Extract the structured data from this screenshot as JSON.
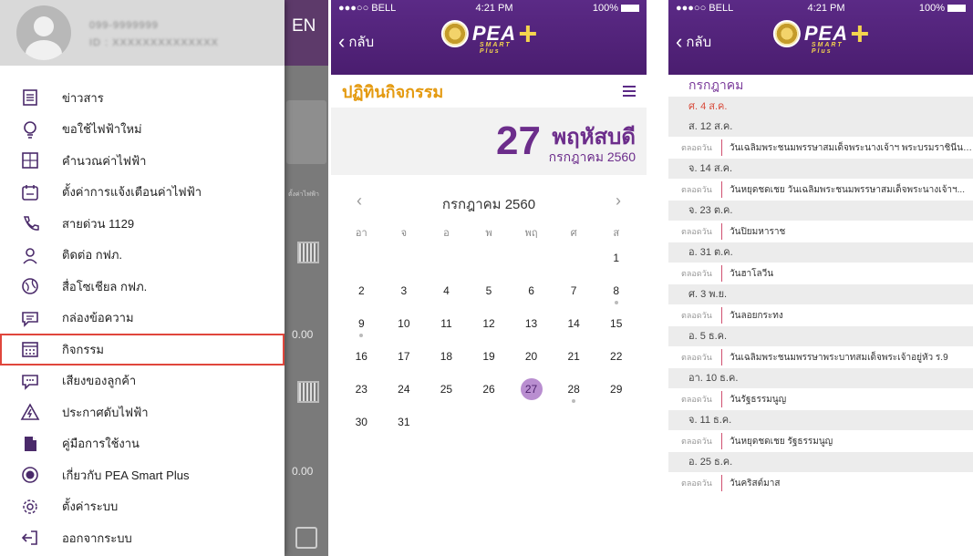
{
  "drawer": {
    "phone": "099-9999999",
    "user_id": "ID : XXXXXXXXXXXXXX",
    "behind_label": "EN",
    "behind_values": [
      "0.00",
      "0.00"
    ],
    "items": [
      {
        "label": "ข่าวสาร",
        "icon": "news-icon"
      },
      {
        "label": "ขอใช้ไฟฟ้าใหม่",
        "icon": "lightbulb-icon"
      },
      {
        "label": "คำนวณค่าไฟฟ้า",
        "icon": "calculator-icon"
      },
      {
        "label": "ตั้งค่าการแจ้งเตือนค่าไฟฟ้า",
        "icon": "bill-alert-icon"
      },
      {
        "label": "สายด่วน 1129",
        "icon": "phone-icon"
      },
      {
        "label": "ติดต่อ กฟภ.",
        "icon": "location-pin-icon"
      },
      {
        "label": "สื่อโซเชียล กฟภ.",
        "icon": "globe-icon"
      },
      {
        "label": "กล่องข้อความ",
        "icon": "message-icon"
      },
      {
        "label": "กิจกรรม",
        "icon": "calendar-icon"
      },
      {
        "label": "เสียงของลูกค้า",
        "icon": "feedback-icon"
      },
      {
        "label": "ประกาศดับไฟฟ้า",
        "icon": "warning-icon"
      },
      {
        "label": "คู่มือการใช้งาน",
        "icon": "manual-icon"
      },
      {
        "label": "เกี่ยวกับ PEA Smart Plus",
        "icon": "pea-logo-icon"
      },
      {
        "label": "ตั้งค่าระบบ",
        "icon": "gear-icon"
      },
      {
        "label": "ออกจากระบบ",
        "icon": "logout-icon"
      }
    ],
    "active_index": 8,
    "highlight_color": "#e0463c"
  },
  "status": {
    "carrier": "●●●○○ BELL",
    "time": "4:21 PM",
    "battery": "100%"
  },
  "nav": {
    "back_label": "กลับ",
    "logo_text": "PEA",
    "logo_sub": "SMART Plus"
  },
  "calendar_screen": {
    "title": "ปฏิทินกิจกรรม",
    "day_number": "27",
    "day_name": "พฤหัสบดี",
    "month_year": "กรกฎาคม 2560",
    "month_title": "กรกฎาคม 2560",
    "weekdays": [
      "อา",
      "จ",
      "อ",
      "พ",
      "พฤ",
      "ศ",
      "ส"
    ],
    "lead_blanks": 6,
    "days": [
      1,
      2,
      3,
      4,
      5,
      6,
      7,
      8,
      9,
      10,
      11,
      12,
      13,
      14,
      15,
      16,
      17,
      18,
      19,
      20,
      21,
      22,
      23,
      24,
      25,
      26,
      27,
      28,
      29,
      30,
      31
    ],
    "selected_day": 27,
    "dotted_days": [
      8,
      9,
      28
    ],
    "accent_color": "#6c2d8b",
    "title_color": "#e49a10"
  },
  "holidays": {
    "month": "กรกฎาคม",
    "tag": "ตลอดวัน",
    "entries": [
      {
        "date": "ศ. 4 ส.ค.",
        "red": true,
        "events": []
      },
      {
        "date": "ส. 12 ส.ค.",
        "red": false,
        "events": [
          "วันเฉลิมพระชนมพรรษาสมเด็จพระนางเจ้าฯ พระบรมราชินีนาถ"
        ]
      },
      {
        "date": "จ. 14 ส.ค.",
        "red": false,
        "events": [
          "วันหยุดชดเชย วันเฉลิมพระชนมพรรษาสมเด็จพระนางเจ้าฯ..."
        ]
      },
      {
        "date": "จ. 23 ต.ค.",
        "red": false,
        "events": [
          "วันปิยมหาราช"
        ]
      },
      {
        "date": "อ. 31 ต.ค.",
        "red": false,
        "events": [
          "วันฮาโลวีน"
        ]
      },
      {
        "date": "ศ. 3 พ.ย.",
        "red": false,
        "events": [
          "วันลอยกระทง"
        ]
      },
      {
        "date": "อ. 5 ธ.ค.",
        "red": false,
        "events": [
          "วันเฉลิมพระชนมพรรษาพระบาทสมเด็จพระเจ้าอยู่หัว ร.9"
        ]
      },
      {
        "date": "อา. 10 ธ.ค.",
        "red": false,
        "events": [
          "วันรัฐธรรมนูญ"
        ]
      },
      {
        "date": "จ. 11 ธ.ค.",
        "red": false,
        "events": [
          "วันหยุดชดเชย รัฐธรรมนูญ"
        ]
      },
      {
        "date": "อ. 25 ธ.ค.",
        "red": false,
        "events": [
          "วันคริสต์มาส"
        ]
      }
    ]
  }
}
